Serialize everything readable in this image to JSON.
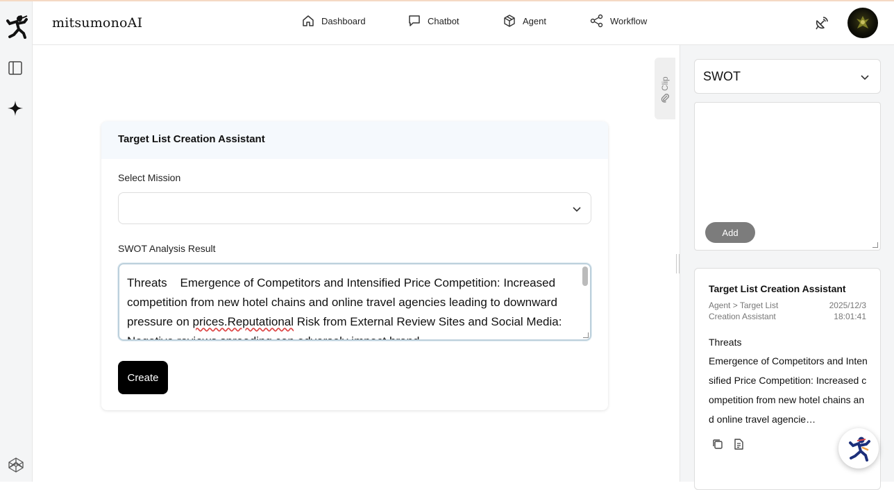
{
  "app": {
    "brand": "mitsumonoAI"
  },
  "nav": {
    "dashboard": "Dashboard",
    "chatbot": "Chatbot",
    "agent": "Agent",
    "workflow": "Workflow"
  },
  "main": {
    "card_title": "Target List Creation Assistant",
    "mission_label": "Select Mission",
    "mission_value": "",
    "swot_label": "SWOT Analysis Result",
    "swot_text_start": "Threats    Emergence of Competitors and Intensified Price Competition: Increased competition from new hotel chains and online travel agencies leading to downward pressure on ",
    "swot_text_squiggle": "prices.Reputational",
    "swot_text_end": " Risk from External Review Sites and Social Media: Negative reviews spreading can adversely impact brand",
    "create_label": "Create"
  },
  "clip": {
    "label": "Clip"
  },
  "right_panel": {
    "select_value": "SWOT",
    "textarea_value": "",
    "add_label": "Add",
    "history": {
      "title": "Target List Creation Assistant",
      "path": "Agent > Target List Creation Assistant",
      "date": "2025/12/3",
      "time": "18:01:41",
      "heading": "Threats",
      "body": "Emergence of Competitors and Intensified Price Competition: Increased competition from new hotel chains and online travel agencie…"
    }
  },
  "icons": {
    "logo": "ninja-logo-icon",
    "panel": "sidebar-panel-icon",
    "spark": "sparkle-icon",
    "cube": "codepen-cube-icon",
    "satellite": "satellite-dish-icon",
    "copy": "copy-icon",
    "doc": "document-icon",
    "clip": "paperclip-icon"
  },
  "colors": {
    "accent": "#000000",
    "add_button": "#7c7c7c",
    "card_header_bg": "#f5f9fd",
    "panel_bg": "#f4f5f6"
  }
}
